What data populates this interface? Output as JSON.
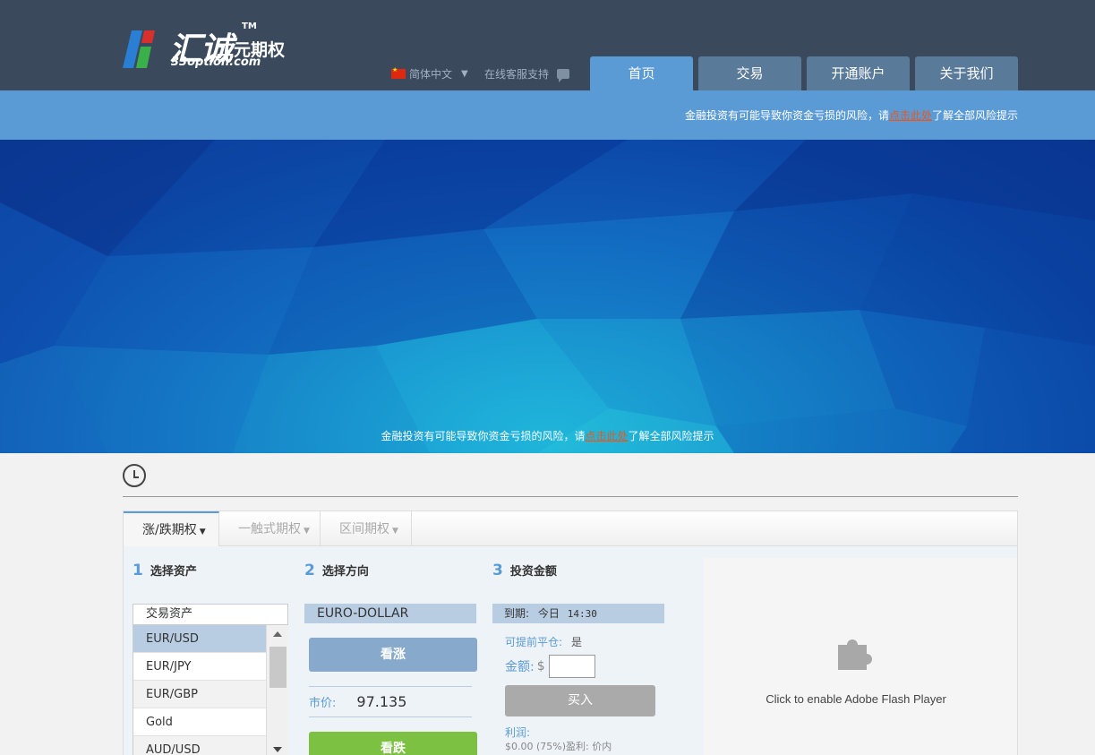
{
  "header": {
    "logo_cn": "汇诚",
    "logo_tm": "TM",
    "logo_subtitle": "二元期权",
    "logo_url": "33option.com",
    "language": "简体中文",
    "support": "在线客服支持",
    "nav": [
      {
        "label": "首页",
        "active": true
      },
      {
        "label": "交易",
        "active": false
      },
      {
        "label": "开通账户",
        "active": false
      },
      {
        "label": "关于我们",
        "active": false
      }
    ]
  },
  "risk": {
    "prefix": "金融投资有可能导致你资金亏损的风险，请",
    "link": "点击此处",
    "suffix": "了解全部风险提示"
  },
  "option_tabs": [
    {
      "label": "涨/跌期权",
      "active": true
    },
    {
      "label": "一触式期权",
      "active": false
    },
    {
      "label": "区间期权",
      "active": false
    }
  ],
  "steps": {
    "s1": {
      "num": "1",
      "label": "选择资产"
    },
    "s2": {
      "num": "2",
      "label": "选择方向"
    },
    "s3": {
      "num": "3",
      "label": "投资金额"
    }
  },
  "assets": {
    "header": "交易资产",
    "items": [
      "EUR/USD",
      "EUR/JPY",
      "EUR/GBP",
      "Gold",
      "AUD/USD"
    ],
    "selected": "EUR/USD"
  },
  "direction": {
    "pair": "EURO-DOLLAR",
    "call": "看涨",
    "price_label": "市价:",
    "price": "97.135",
    "put": "看跌"
  },
  "investment": {
    "expiry_label": "到期:",
    "expiry_day": "今日",
    "expiry_time": "14:30",
    "early_close_label": "可提前平仓:",
    "early_close_value": "是",
    "amount_label": "金额:",
    "currency": "$",
    "buy": "买入",
    "profit_label": "利润:",
    "profit_detail": "$0.00 (75%)盈利: 价内"
  },
  "flash": {
    "text": "Click to enable Adobe Flash Player"
  },
  "colors": {
    "header_bg": "#3a4a5c",
    "accent": "#5b9bd5",
    "call_btn": "#87a9cb",
    "put_btn": "#7cc142",
    "risk_link": "#e8571e"
  }
}
